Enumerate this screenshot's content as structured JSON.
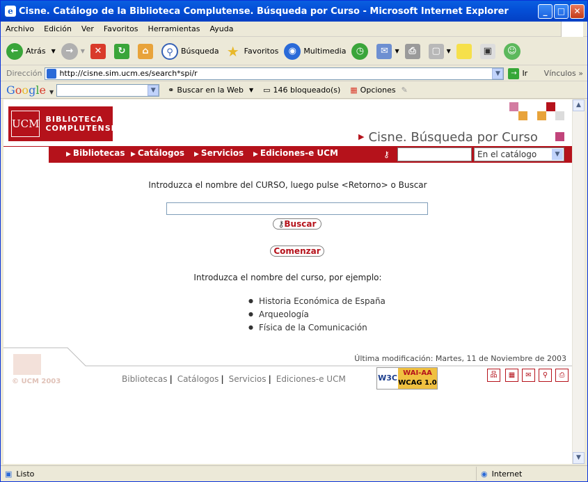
{
  "window": {
    "title": "Cisne. Catálogo de la Biblioteca Complutense. Búsqueda por Curso - Microsoft Internet Explorer"
  },
  "menu": [
    "Archivo",
    "Edición",
    "Ver",
    "Favoritos",
    "Herramientas",
    "Ayuda"
  ],
  "toolbar": {
    "back": "Atrás",
    "search": "Búsqueda",
    "favorites": "Favoritos",
    "media": "Multimedia"
  },
  "address": {
    "label": "Dirección",
    "url": "http://cisne.sim.ucm.es/search*spi/r",
    "go": "Ir",
    "links": "Vínculos"
  },
  "google": {
    "logo": "Google",
    "search_web": "Buscar en la Web",
    "blocked": "146 bloqueado(s)",
    "options": "Opciones"
  },
  "page": {
    "logo_ucm": "UCM",
    "logo_line1": "BIBLIOTECA",
    "logo_line2": "COMPLUTENSE",
    "heading": "Cisne. Búsqueda por Curso",
    "nav": [
      "Bibliotecas",
      "Catálogos",
      "Servicios",
      "Ediciones-e UCM"
    ],
    "nav_select": "En el catálogo",
    "instruction": "Introduzca el nombre del CURSO, luego pulse <Retorno> o Buscar",
    "search_button": "Buscar",
    "start_button": "Comenzar",
    "example_intro": "Introduzca el nombre del curso, por ejemplo:",
    "examples": [
      "Historia Económica de España",
      "Arqueología",
      "Física de la Comunicación"
    ],
    "last_modified": "Última modificación: Martes, 11 de Noviembre de 2003",
    "footer_links": [
      "Bibliotecas",
      "Catálogos",
      "Servicios",
      "Ediciones-e UCM"
    ],
    "copyright": "© UCM 2003",
    "w3c": "W3C",
    "wai_line1": "WAI-AA",
    "wai_line2": "WCAG 1.0"
  },
  "status": {
    "left": "Listo",
    "zone": "Internet"
  }
}
